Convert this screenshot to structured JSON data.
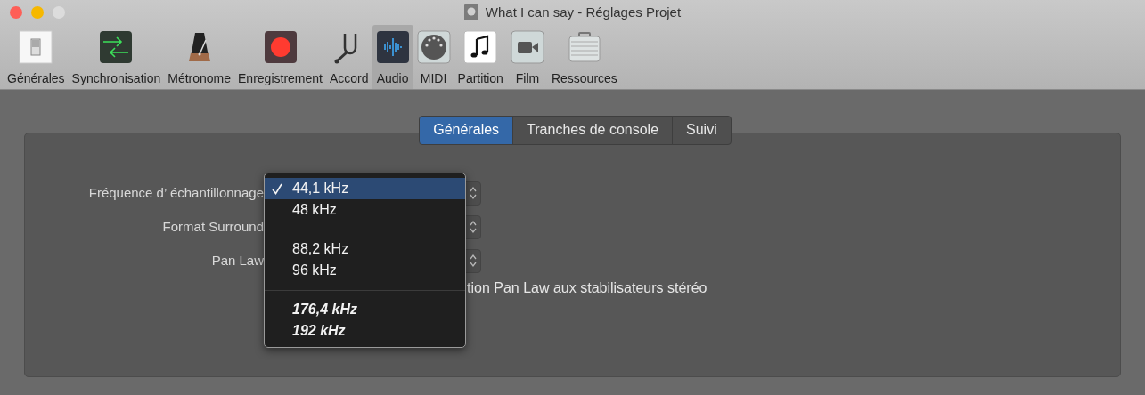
{
  "window": {
    "title": "What I can say - Réglages Projet"
  },
  "toolbar": [
    {
      "label": "Générales",
      "selected": false
    },
    {
      "label": "Synchronisation",
      "selected": false
    },
    {
      "label": "Métronome",
      "selected": false
    },
    {
      "label": "Enregistrement",
      "selected": false
    },
    {
      "label": "Accord",
      "selected": false
    },
    {
      "label": "Audio",
      "selected": true
    },
    {
      "label": "MIDI",
      "selected": false
    },
    {
      "label": "Partition",
      "selected": false
    },
    {
      "label": "Film",
      "selected": false
    },
    {
      "label": "Ressources",
      "selected": false
    }
  ],
  "segments": [
    {
      "label": "Générales",
      "selected": true
    },
    {
      "label": "Tranches de console",
      "selected": false
    },
    {
      "label": "Suivi",
      "selected": false
    }
  ],
  "form": {
    "rows": [
      {
        "label": "Fréquence d’ échantillonnage"
      },
      {
        "label": "Format Surround"
      },
      {
        "label": "Pan Law"
      }
    ],
    "checkbox_label": "tion Pan Law aux stabilisateurs stéréo"
  },
  "menu": {
    "sections": [
      [
        {
          "label": "44,1 kHz",
          "selected": true,
          "kind": "normal"
        },
        {
          "label": "48 kHz",
          "selected": false,
          "kind": "normal"
        }
      ],
      [
        {
          "label": "88,2 kHz",
          "selected": false,
          "kind": "normal"
        },
        {
          "label": "96 kHz",
          "selected": false,
          "kind": "normal"
        }
      ],
      [
        {
          "label": "176,4 kHz",
          "selected": false,
          "kind": "emphasized"
        },
        {
          "label": "192 kHz",
          "selected": false,
          "kind": "emphasized"
        }
      ]
    ]
  }
}
